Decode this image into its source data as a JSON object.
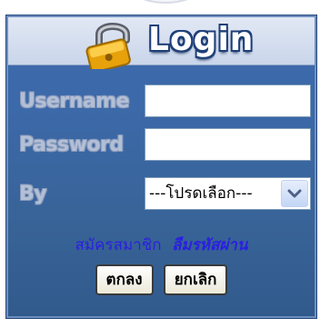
{
  "login_box": {
    "title": "Login",
    "lock_icon": "padlock-icon",
    "username_label": "Username",
    "username_value": "",
    "password_label": "Password",
    "password_value": "",
    "by_label": "By",
    "by_selected": "---โปรดเลือก---",
    "register_link": "สมัครสมาชิก",
    "forgot_link": "ลืมรหัสผ่าน",
    "ok_button": "ตกลง",
    "cancel_button": "ยกเลิก"
  },
  "colors": {
    "panel_blue": "#3b6aae",
    "header_bg": "#d4ddee",
    "link_blue": "#2a1fe0",
    "label_gray": "#b3bfd5",
    "lock_gold": "#f2b418"
  }
}
